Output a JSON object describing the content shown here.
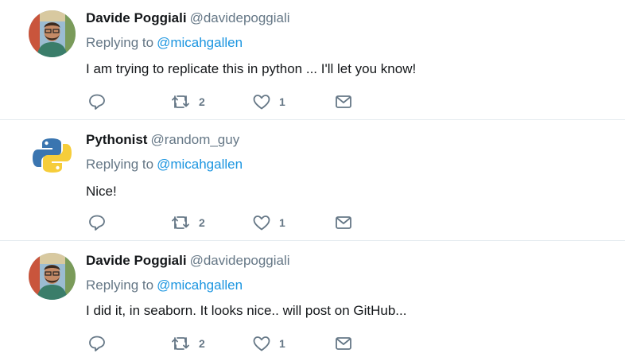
{
  "tweets": [
    {
      "name": "Davide Poggiali",
      "handle": "@davidepoggiali",
      "replying_prefix": "Replying to",
      "replying_to": "@micahgallen",
      "text": "I am trying to replicate this in python ... I'll let you know!",
      "retweets": "2",
      "likes": "1",
      "avatar": "person-photo"
    },
    {
      "name": "Pythonist",
      "handle": "@random_guy",
      "replying_prefix": "Replying to",
      "replying_to": "@micahgallen",
      "text": "Nice!",
      "retweets": "2",
      "likes": "1",
      "avatar": "python-logo"
    },
    {
      "name": "Davide Poggiali",
      "handle": "@davidepoggiali",
      "replying_prefix": "Replying to",
      "replying_to": "@micahgallen",
      "text": "I did it, in seaborn. It looks nice.. will post on GitHub...",
      "retweets": "2",
      "likes": "1",
      "avatar": "person-photo"
    }
  ],
  "colors": {
    "handle": "#657786",
    "link": "#1b95e0",
    "icon": "#657786",
    "divider": "#e6ecf0"
  },
  "icons": [
    "reply-icon",
    "retweet-icon",
    "like-icon",
    "message-icon"
  ]
}
